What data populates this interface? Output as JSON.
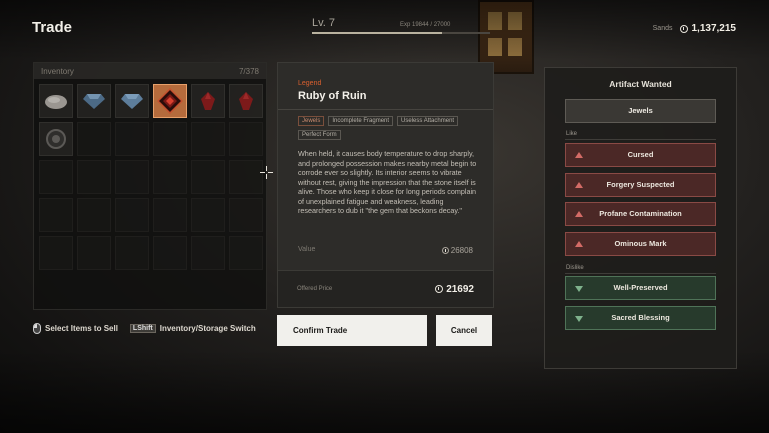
{
  "header": {
    "title": "Trade",
    "level": "Lv. 7",
    "exp_text": "Exp 19844 / 27000",
    "exp_fraction": 0.73,
    "currency_label": "Sands",
    "currency_value": "1,137,215"
  },
  "inventory": {
    "title": "Inventory",
    "capacity": "7/378",
    "items": [
      {
        "icon": "gray-stone-icon",
        "color": "#9a9691"
      },
      {
        "icon": "blue-gem-icon",
        "color": "#4c6a86"
      },
      {
        "icon": "blue-gem-icon",
        "color": "#5d7d9b"
      },
      {
        "icon": "ruby-of-ruin-icon",
        "color": "#7a1915",
        "selected": true
      },
      {
        "icon": "red-shard-icon",
        "color": "#7c1a1a"
      },
      {
        "icon": "red-shard-icon",
        "color": "#7c1a1a"
      },
      {
        "icon": "dark-disc-icon",
        "color": "#5b5956"
      }
    ]
  },
  "hints": {
    "select": "Select Items to Sell",
    "key": "LShift",
    "switch": "Inventory/Storage Switch"
  },
  "item": {
    "rarity": "Legend",
    "rarity_color": "#d9602f",
    "name": "Ruby of Ruin",
    "tags": [
      "Jewels",
      "Incomplete Fragment",
      "Useless Attachment",
      "Perfect Form"
    ],
    "description": "When held, it causes body temperature to drop sharply, and prolonged possession makes nearby metal begin to corrode ever so slightly. Its interior seems to vibrate without rest, giving the impression that the stone itself is alive. Those who keep it close for long periods complain of unexplained fatigue and weakness, leading researchers to dub it \"the gem that beckons decay.\"",
    "value_label": "Value",
    "value": "26808",
    "offered_label": "Offered Price",
    "offered_price": "21692"
  },
  "actions": {
    "confirm": "Confirm Trade",
    "cancel": "Cancel"
  },
  "artifact_wanted": {
    "title": "Artifact Wanted",
    "category": "Jewels",
    "like_label": "Like",
    "likes": [
      "Cursed",
      "Forgery Suspected",
      "Profane Contamination",
      "Ominous Mark"
    ],
    "dislike_label": "Dislike",
    "dislikes": [
      "Well-Preserved",
      "Sacred Blessing"
    ]
  },
  "colors": {
    "like_bg": "#4b2826",
    "dislike_bg": "#273a2c",
    "selected_slot": "#b56b3c"
  }
}
